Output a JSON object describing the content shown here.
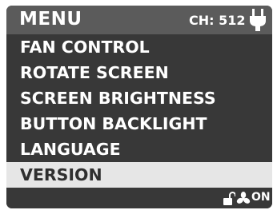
{
  "header": {
    "title": "MENU",
    "channel": "CH: 512",
    "power_icon": "plug-icon"
  },
  "menu": {
    "items": [
      {
        "label": "FAN CONTROL",
        "selected": false
      },
      {
        "label": "ROTATE SCREEN",
        "selected": false
      },
      {
        "label": "SCREEN BRIGHTNESS",
        "selected": false
      },
      {
        "label": "BUTTON BACKLIGHT",
        "selected": false
      },
      {
        "label": "LANGUAGE",
        "selected": false
      },
      {
        "label": "VERSION",
        "selected": true
      }
    ]
  },
  "footer": {
    "lock_icon": "unlock-icon",
    "fan_icon": "fan-icon",
    "status": "ON"
  },
  "colors": {
    "screen_bg": "#383838",
    "header_bg": "#5b5b5b",
    "selected_bg": "#e6e6e6",
    "text": "#ffffff"
  }
}
